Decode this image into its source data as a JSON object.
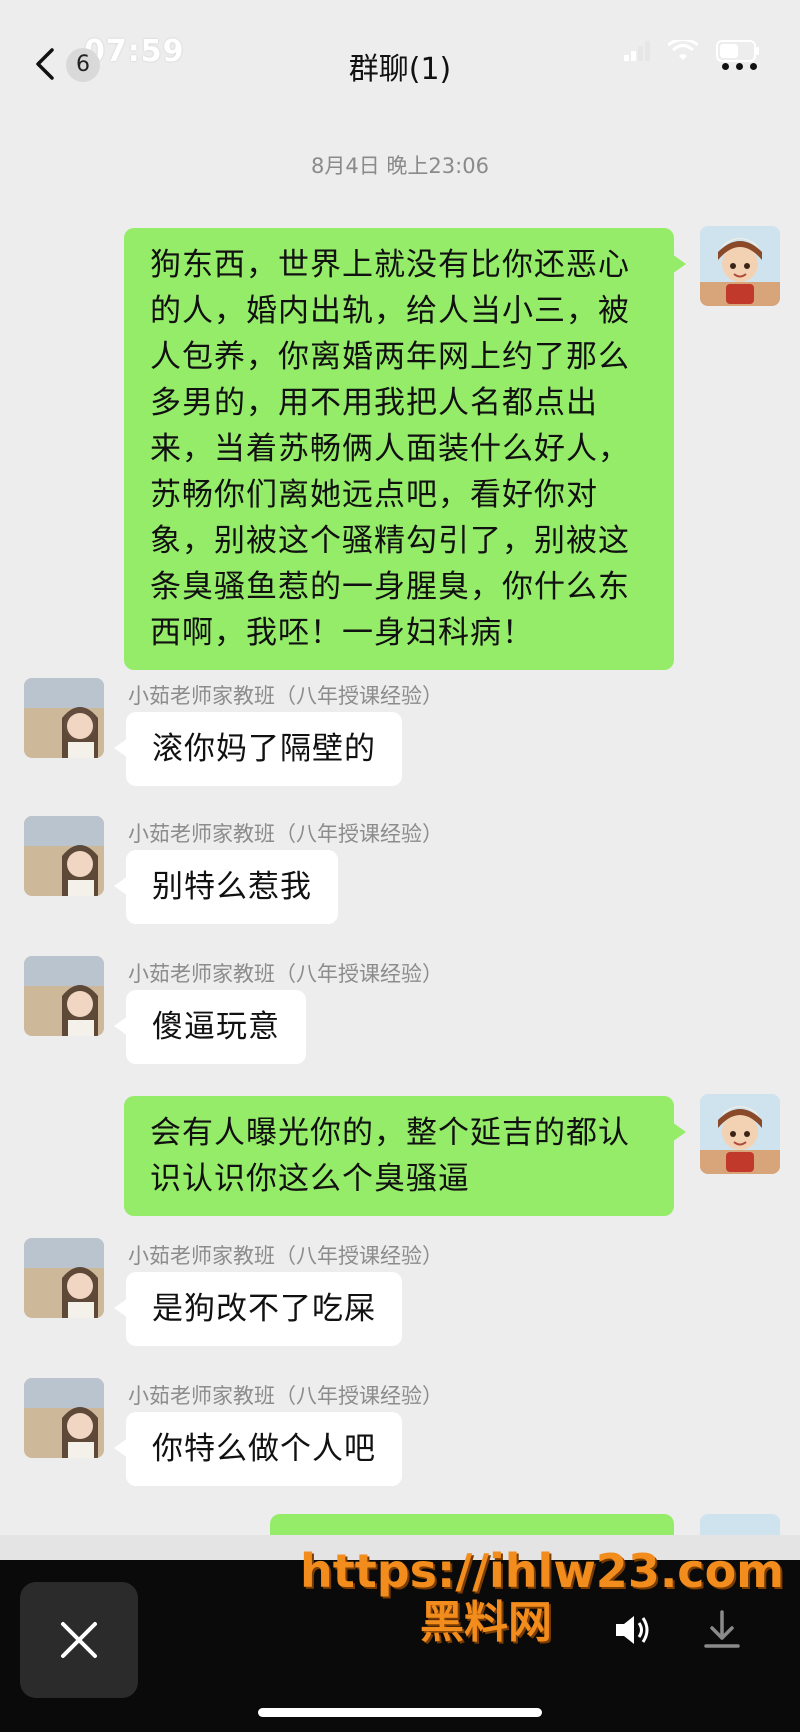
{
  "status_bar": {
    "time": "07:59"
  },
  "nav": {
    "back_count": "6",
    "title": "群聊(1)"
  },
  "chat": {
    "timestamp": "8月4日 晚上23:06",
    "messages": [
      {
        "side": "me",
        "text": "狗东西，世界上就没有比你还恶心的人，婚内出轨，给人当小三，被人包养，你离婚两年网上约了那么多男的，用不用我把人名都点出来，当着苏畅俩人面装什么好人，苏畅你们离她远点吧，看好你对象，别被这个骚精勾引了，别被这条臭骚鱼惹的一身腥臭，你什么东西啊，我呸！一身妇科病！"
      },
      {
        "side": "other",
        "sender": "小茹老师家教班（八年授课经验）",
        "text": "滚你妈了隔壁的"
      },
      {
        "side": "other",
        "sender": "小茹老师家教班（八年授课经验）",
        "text": "别特么惹我"
      },
      {
        "side": "other",
        "sender": "小茹老师家教班（八年授课经验）",
        "text": "傻逼玩意"
      },
      {
        "side": "me",
        "text": "会有人曝光你的，整个延吉的都认识认识你这么个臭骚逼"
      },
      {
        "side": "other",
        "sender": "小茹老师家教班（八年授课经验）",
        "text": "是狗改不了吃屎"
      },
      {
        "side": "other",
        "sender": "小茹老师家教班（八年授课经验）",
        "text": "你特么做个人吧"
      }
    ]
  },
  "watermark": {
    "url": "https://ihlw23.com",
    "name": "黑料网"
  },
  "colors": {
    "my_bubble": "#95ec69",
    "other_bubble": "#ffffff",
    "background": "#ededed",
    "watermark": "#f28c1c"
  },
  "icons": [
    "back-chevron-icon",
    "signal-icon",
    "wifi-icon",
    "battery-icon",
    "more-icon",
    "close-icon",
    "volume-icon",
    "download-icon"
  ]
}
